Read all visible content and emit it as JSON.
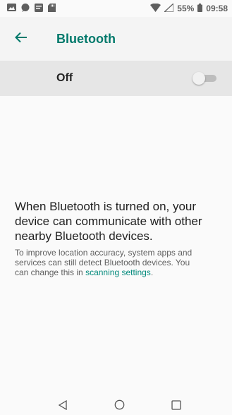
{
  "status_bar": {
    "battery_percent": "55%",
    "time": "09:58",
    "icons": [
      "photo-icon",
      "chat-icon",
      "sms-icon",
      "sd-card-icon",
      "wifi-icon",
      "signal-icon",
      "battery-icon"
    ]
  },
  "app_bar": {
    "title": "Bluetooth",
    "back_icon": "arrow-back-icon"
  },
  "master_switch": {
    "label": "Off",
    "state": "off"
  },
  "info": {
    "main_text": "When Bluetooth is turned on, your device can communicate with other nearby Bluetooth devices.",
    "sub_text_prefix": "To improve location accuracy, system apps and services can still detect Bluetooth devices. You can change this in ",
    "sub_text_link": "scanning settings",
    "sub_text_suffix": "."
  },
  "nav_bar": {
    "buttons": [
      "back-nav-icon",
      "home-nav-icon",
      "recents-nav-icon"
    ]
  },
  "colors": {
    "accent": "#00796b",
    "link": "#00897b",
    "appbar_bg": "#f4f4f4",
    "switch_row_bg": "#e6e6e6"
  }
}
